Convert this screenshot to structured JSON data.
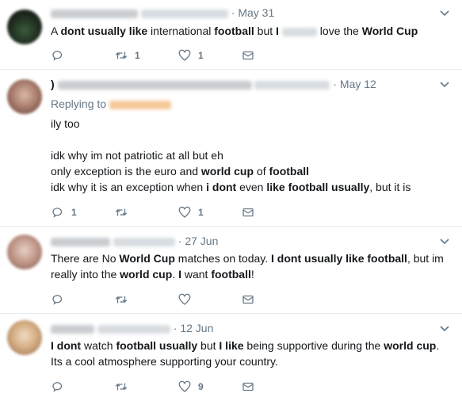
{
  "tweets": [
    {
      "date": "May 31",
      "dot": "·",
      "segments": [
        {
          "t": "A ",
          "b": false
        },
        {
          "t": "dont usually like",
          "b": true
        },
        {
          "t": " international ",
          "b": false
        },
        {
          "t": "football",
          "b": true
        },
        {
          "t": " but ",
          "b": false
        },
        {
          "t": "I",
          "b": true
        },
        {
          "t": "      ",
          "b": false,
          "blur": true
        },
        {
          "t": " love the ",
          "b": false
        },
        {
          "t": "World Cup",
          "b": true
        }
      ],
      "reply_count": "",
      "retweet_count": "1",
      "like_count": "1"
    },
    {
      "date": "May 12",
      "dot": "·",
      "name_start": ")",
      "replying_label": "Replying to",
      "lines": [
        [
          {
            "t": "ily too",
            "b": false
          }
        ],
        [
          {
            "t": "",
            "b": false
          }
        ],
        [
          {
            "t": "idk why im not patriotic at all but eh",
            "b": false
          }
        ],
        [
          {
            "t": "only exception is the euro and ",
            "b": false
          },
          {
            "t": "world cup",
            "b": true
          },
          {
            "t": " of ",
            "b": false
          },
          {
            "t": "football",
            "b": true
          }
        ],
        [
          {
            "t": "idk why it is an exception when ",
            "b": false
          },
          {
            "t": "i dont",
            "b": true
          },
          {
            "t": " even ",
            "b": false
          },
          {
            "t": "like football usually",
            "b": true
          },
          {
            "t": ", but it is",
            "b": false
          }
        ]
      ],
      "reply_count": "1",
      "retweet_count": "",
      "like_count": "1"
    },
    {
      "date": "27 Jun",
      "dot": "·",
      "lines": [
        [
          {
            "t": "There are No ",
            "b": false
          },
          {
            "t": "World Cup",
            "b": true
          },
          {
            "t": " matches on today. ",
            "b": false
          },
          {
            "t": "I dont usually like football",
            "b": true
          },
          {
            "t": ", but im",
            "b": false
          }
        ],
        [
          {
            "t": "really into the ",
            "b": false
          },
          {
            "t": "world cup",
            "b": true
          },
          {
            "t": ". ",
            "b": false
          },
          {
            "t": "I",
            "b": true
          },
          {
            "t": " want ",
            "b": false
          },
          {
            "t": "football",
            "b": true
          },
          {
            "t": "!",
            "b": false
          }
        ]
      ],
      "reply_count": "",
      "retweet_count": "",
      "like_count": ""
    },
    {
      "date": "12 Jun",
      "dot": "·",
      "lines": [
        [
          {
            "t": "I dont",
            "b": true
          },
          {
            "t": " watch ",
            "b": false
          },
          {
            "t": "football usually",
            "b": true
          },
          {
            "t": " but ",
            "b": false
          },
          {
            "t": "I like",
            "b": true
          },
          {
            "t": " being supportive during the ",
            "b": false
          },
          {
            "t": "world cup",
            "b": true
          },
          {
            "t": ".",
            "b": false
          }
        ],
        [
          {
            "t": "Its a cool atmosphere supporting your country.",
            "b": false
          }
        ]
      ],
      "reply_count": "",
      "retweet_count": "",
      "like_count": "9"
    }
  ],
  "colors": {
    "accent": "#1da1f2",
    "icon": "#657786",
    "text": "#14171a",
    "divider": "#e6ecf0"
  }
}
